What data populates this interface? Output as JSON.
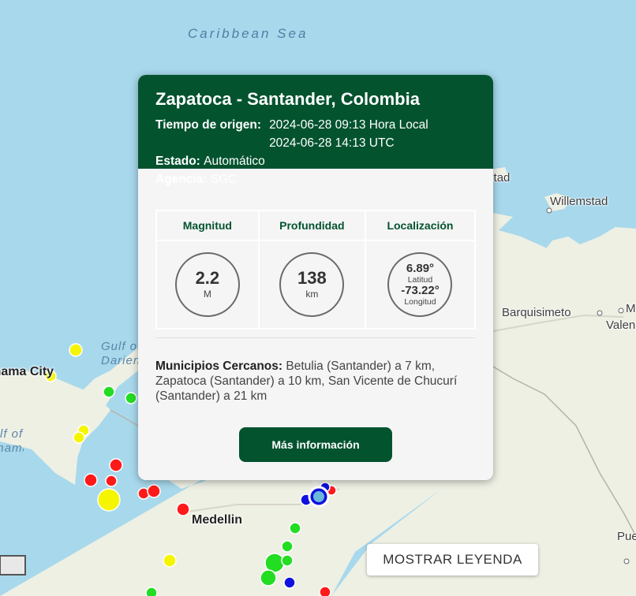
{
  "map": {
    "sea_label": "Caribbean Sea",
    "gulf_label_1": "Gulf of",
    "gulf_label_2": "Darien",
    "places": {
      "oranjestad": "Oranjestad",
      "willemstad": "Willemstad",
      "barquisimeto": "Barquisimeto",
      "valencia": "Valencia",
      "panama_city": "Panama City",
      "gulf_panama_1": "Gulf of",
      "gulf_panama_2": "Panama",
      "medellin": "Medellin",
      "puerto_ayacucho": "Puerto Ayacucho",
      "maracay_partial": "M"
    },
    "colors": {
      "sea": "#a8d8ec",
      "land": "#eef0e4",
      "red": "#ff0000",
      "yellow": "#f5f500",
      "green": "#22dd22",
      "blue": "#1010e0"
    }
  },
  "popup": {
    "title": "Zapatoca - Santander, Colombia",
    "origin_label": "Tiempo de origen:",
    "origin_local": "2024-06-28 09:13 Hora Local",
    "origin_utc": "2024-06-28 14:13 UTC",
    "status_label": "Estado:",
    "status_value": "Automático",
    "agency_label": "Agencia:",
    "agency_value": "SGC",
    "headers": {
      "magnitude": "Magnitud",
      "depth": "Profundidad",
      "location": "Localización"
    },
    "magnitude": {
      "value": "2.2",
      "unit": "M"
    },
    "depth": {
      "value": "138",
      "unit": "km"
    },
    "location": {
      "lat": "6.89°",
      "lat_label": "Latitud",
      "lon": "-73.22°",
      "lon_label": "Longitud"
    },
    "municipalities_label": "Municipios Cercanos:",
    "municipalities_text": "Betulia (Santander) a 7 km, Zapatoca (Santander) a 10 km, San Vicente de Chucurí (Santander) a 21 km",
    "more_button": "Más información",
    "header_color": "#03532f"
  },
  "legend_button": "MOSTRAR LEYENDA"
}
